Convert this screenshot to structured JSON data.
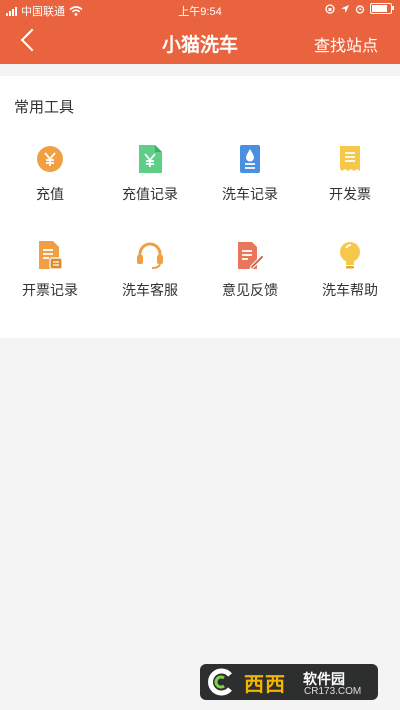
{
  "status_bar": {
    "carrier": "中国联通",
    "time": "上午9:54",
    "battery_level": 0.85
  },
  "nav": {
    "title": "小猫洗车",
    "right_action": "查找站点"
  },
  "tools": {
    "section_title": "常用工具",
    "items": [
      {
        "label": "充值",
        "icon": "recharge-coin-icon"
      },
      {
        "label": "充值记录",
        "icon": "recharge-record-icon"
      },
      {
        "label": "洗车记录",
        "icon": "wash-record-icon"
      },
      {
        "label": "开发票",
        "icon": "invoice-icon"
      },
      {
        "label": "开票记录",
        "icon": "invoice-record-icon"
      },
      {
        "label": "洗车客服",
        "icon": "headset-icon"
      },
      {
        "label": "意见反馈",
        "icon": "feedback-icon"
      },
      {
        "label": "洗车帮助",
        "icon": "lightbulb-icon"
      }
    ]
  },
  "watermark": {
    "brand": "西西",
    "name": "软件园",
    "url": "CR173.COM"
  },
  "colors": {
    "header": "#e9643e",
    "background": "#f4f4f4",
    "text": "#333333"
  }
}
